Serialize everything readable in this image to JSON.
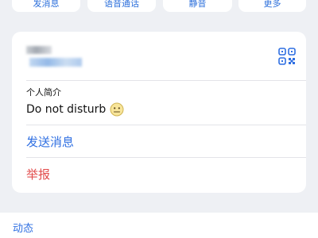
{
  "actions": [
    {
      "label": "发消息"
    },
    {
      "label": "语音通话"
    },
    {
      "label": "静音"
    },
    {
      "label": "更多"
    }
  ],
  "profile": {
    "qr_icon": "qr-code-icon",
    "bio_label": "个人简介",
    "bio_text": "Do not disturb",
    "bio_emoji": "neutral-face-emoji"
  },
  "menu": {
    "send_message": "发送消息",
    "report": "举报"
  },
  "feed": {
    "label": "动态"
  },
  "colors": {
    "accent": "#2f6fe2",
    "danger": "#e24b4b",
    "background": "#eef0f4"
  }
}
